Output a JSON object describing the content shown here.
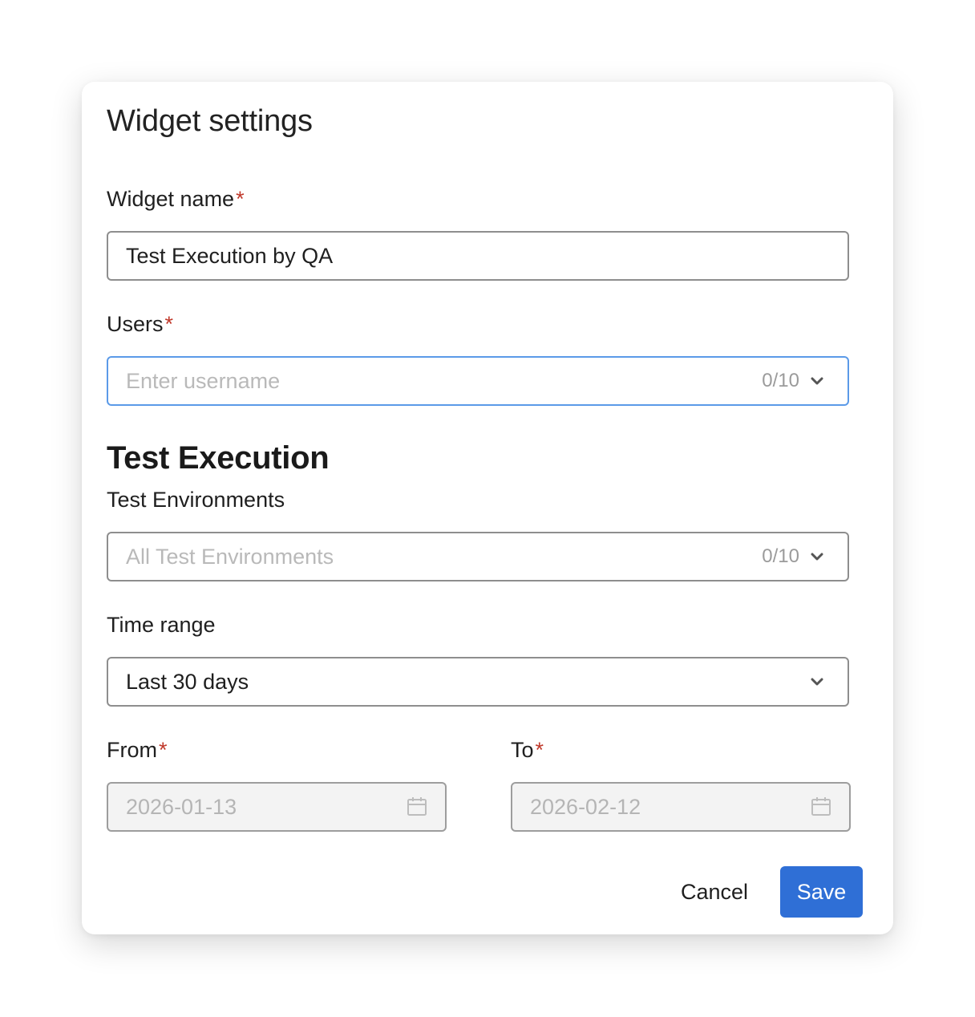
{
  "dialog": {
    "title": "Widget settings",
    "widget_name": {
      "label": "Widget name",
      "required_mark": "*",
      "value": "Test Execution by QA"
    },
    "users": {
      "label": "Users",
      "required_mark": "*",
      "placeholder": "Enter username",
      "counter": "0/10"
    },
    "section_heading": "Test Execution",
    "test_environments": {
      "label": "Test Environments",
      "placeholder": "All Test Environments",
      "counter": "0/10"
    },
    "time_range": {
      "label": "Time range",
      "value": "Last 30 days"
    },
    "from": {
      "label": "From",
      "required_mark": "*",
      "value": "2026-01-13"
    },
    "to": {
      "label": "To",
      "required_mark": "*",
      "value": "2026-02-12"
    },
    "buttons": {
      "cancel": "Cancel",
      "save": "Save"
    }
  },
  "colors": {
    "primary": "#2f6fd6",
    "focus_border": "#5b9ae8",
    "required": "#c0392b"
  },
  "icons": [
    "chevron-down-icon",
    "calendar-icon"
  ]
}
